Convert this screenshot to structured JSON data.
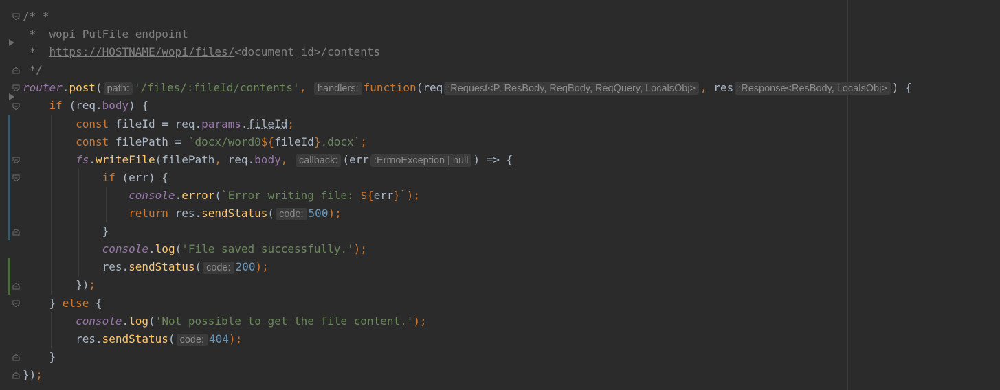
{
  "editor": {
    "language": "javascript",
    "colors": {
      "background": "#2b2b2b",
      "comment": "#808080",
      "keyword": "#cc7832",
      "string": "#6a8759",
      "number": "#6897bb",
      "function": "#ffc66d",
      "field": "#9876aa",
      "text": "#a9b7c6",
      "hint_bg": "#3b3b3b",
      "change_marker": "#3a5a6c",
      "added_marker": "#4a6b3a"
    },
    "gutter": {
      "fold_icon": "fold-icon",
      "run_icon": "run-arrow-icon"
    },
    "lines": [
      {
        "indent": 0,
        "tokens": [
          {
            "t": "/* *",
            "k": "c"
          }
        ]
      },
      {
        "indent": 0,
        "tokens": [
          {
            "t": " *  wopi PutFile endpoint",
            "k": "c"
          }
        ]
      },
      {
        "indent": 0,
        "tokens": [
          {
            "t": " *  ",
            "k": "c"
          },
          {
            "t": "https://HOSTNAME/wopi/files/",
            "k": "url"
          },
          {
            "t": "<document_id>/contents",
            "k": "c"
          }
        ]
      },
      {
        "indent": 0,
        "tokens": [
          {
            "t": " */",
            "k": "c"
          }
        ]
      },
      {
        "indent": 0,
        "tokens": [
          {
            "t": "router",
            "k": "glob"
          },
          {
            "t": ".",
            "k": "plain"
          },
          {
            "t": "post",
            "k": "fn"
          },
          {
            "t": "(",
            "k": "plain"
          },
          {
            "t": "path:",
            "k": "hint"
          },
          {
            "t": "'/files/:fileId/contents'",
            "k": "str"
          },
          {
            "t": ", ",
            "k": "kw"
          },
          {
            "t": "handlers:",
            "k": "hint"
          },
          {
            "t": "function",
            "k": "kw"
          },
          {
            "t": "(req",
            "k": "plain"
          },
          {
            "t": ":Request<P, ResBody, ReqBody, ReqQuery, LocalsObj>",
            "k": "hint"
          },
          {
            "t": ", ",
            "k": "kw"
          },
          {
            "t": "res",
            "k": "plain"
          },
          {
            "t": ":Response<ResBody, LocalsObj>",
            "k": "hint"
          },
          {
            "t": ") {",
            "k": "plain"
          }
        ]
      },
      {
        "indent": 1,
        "tokens": [
          {
            "t": "if ",
            "k": "kw"
          },
          {
            "t": "(req.",
            "k": "plain"
          },
          {
            "t": "body",
            "k": "fld"
          },
          {
            "t": ") {",
            "k": "plain"
          }
        ]
      },
      {
        "indent": 2,
        "tokens": [
          {
            "t": "const ",
            "k": "kw"
          },
          {
            "t": "fileId = req.",
            "k": "plain"
          },
          {
            "t": "params",
            "k": "fld"
          },
          {
            "t": ".",
            "k": "plain"
          },
          {
            "t": "fileId",
            "k": "wavy"
          },
          {
            "t": ";",
            "k": "kw"
          }
        ]
      },
      {
        "indent": 2,
        "tokens": [
          {
            "t": "const ",
            "k": "kw"
          },
          {
            "t": "filePath = ",
            "k": "plain"
          },
          {
            "t": "`docx/word0",
            "k": "str"
          },
          {
            "t": "${",
            "k": "kw"
          },
          {
            "t": "fileId",
            "k": "plain"
          },
          {
            "t": "}",
            "k": "kw"
          },
          {
            "t": ".docx`",
            "k": "str"
          },
          {
            "t": ";",
            "k": "kw"
          }
        ]
      },
      {
        "indent": 2,
        "tokens": [
          {
            "t": "fs",
            "k": "glob"
          },
          {
            "t": ".",
            "k": "plain"
          },
          {
            "t": "writeFile",
            "k": "fn"
          },
          {
            "t": "(filePath",
            "k": "plain"
          },
          {
            "t": ", ",
            "k": "kw"
          },
          {
            "t": "req.",
            "k": "plain"
          },
          {
            "t": "body",
            "k": "fld"
          },
          {
            "t": ", ",
            "k": "kw"
          },
          {
            "t": "callback:",
            "k": "hint"
          },
          {
            "t": "(err",
            "k": "plain"
          },
          {
            "t": ":ErrnoException | null",
            "k": "hint"
          },
          {
            "t": ") => {",
            "k": "plain"
          }
        ]
      },
      {
        "indent": 3,
        "tokens": [
          {
            "t": "if ",
            "k": "kw"
          },
          {
            "t": "(err) {",
            "k": "plain"
          }
        ]
      },
      {
        "indent": 4,
        "tokens": [
          {
            "t": "console",
            "k": "glob"
          },
          {
            "t": ".",
            "k": "plain"
          },
          {
            "t": "error",
            "k": "fn"
          },
          {
            "t": "(",
            "k": "plain"
          },
          {
            "t": "`Error writing file: ",
            "k": "str"
          },
          {
            "t": "${",
            "k": "kw"
          },
          {
            "t": "err",
            "k": "plain"
          },
          {
            "t": "}",
            "k": "kw"
          },
          {
            "t": "`",
            "k": "str"
          },
          {
            "t": ");",
            "k": "kw"
          }
        ]
      },
      {
        "indent": 4,
        "tokens": [
          {
            "t": "return ",
            "k": "kw"
          },
          {
            "t": "res.",
            "k": "plain"
          },
          {
            "t": "sendStatus",
            "k": "fn"
          },
          {
            "t": "(",
            "k": "plain"
          },
          {
            "t": "code:",
            "k": "hint"
          },
          {
            "t": "500",
            "k": "num"
          },
          {
            "t": ");",
            "k": "kw"
          }
        ]
      },
      {
        "indent": 3,
        "tokens": [
          {
            "t": "}",
            "k": "plain"
          }
        ]
      },
      {
        "indent": 3,
        "tokens": [
          {
            "t": "console",
            "k": "glob"
          },
          {
            "t": ".",
            "k": "plain"
          },
          {
            "t": "log",
            "k": "fn"
          },
          {
            "t": "(",
            "k": "plain"
          },
          {
            "t": "'File saved successfully.'",
            "k": "str"
          },
          {
            "t": ");",
            "k": "kw"
          }
        ]
      },
      {
        "indent": 3,
        "tokens": [
          {
            "t": "res.",
            "k": "plain"
          },
          {
            "t": "sendStatus",
            "k": "fn"
          },
          {
            "t": "(",
            "k": "plain"
          },
          {
            "t": "code:",
            "k": "hint"
          },
          {
            "t": "200",
            "k": "num"
          },
          {
            "t": ");",
            "k": "kw"
          }
        ]
      },
      {
        "indent": 2,
        "tokens": [
          {
            "t": "})",
            "k": "plain"
          },
          {
            "t": ";",
            "k": "kw"
          }
        ]
      },
      {
        "indent": 1,
        "tokens": [
          {
            "t": "} ",
            "k": "plain"
          },
          {
            "t": "else ",
            "k": "kw"
          },
          {
            "t": "{",
            "k": "plain"
          }
        ]
      },
      {
        "indent": 2,
        "tokens": [
          {
            "t": "console",
            "k": "glob"
          },
          {
            "t": ".",
            "k": "plain"
          },
          {
            "t": "log",
            "k": "fn"
          },
          {
            "t": "(",
            "k": "plain"
          },
          {
            "t": "'Not possible to get the file content.'",
            "k": "str"
          },
          {
            "t": ");",
            "k": "kw"
          }
        ]
      },
      {
        "indent": 2,
        "tokens": [
          {
            "t": "res.",
            "k": "plain"
          },
          {
            "t": "sendStatus",
            "k": "fn"
          },
          {
            "t": "(",
            "k": "plain"
          },
          {
            "t": "code:",
            "k": "hint"
          },
          {
            "t": "404",
            "k": "num"
          },
          {
            "t": ");",
            "k": "kw"
          }
        ]
      },
      {
        "indent": 1,
        "tokens": [
          {
            "t": "}",
            "k": "plain"
          }
        ]
      },
      {
        "indent": 0,
        "tokens": [
          {
            "t": "})",
            "k": "plain"
          },
          {
            "t": ";",
            "k": "kw"
          }
        ]
      }
    ]
  }
}
